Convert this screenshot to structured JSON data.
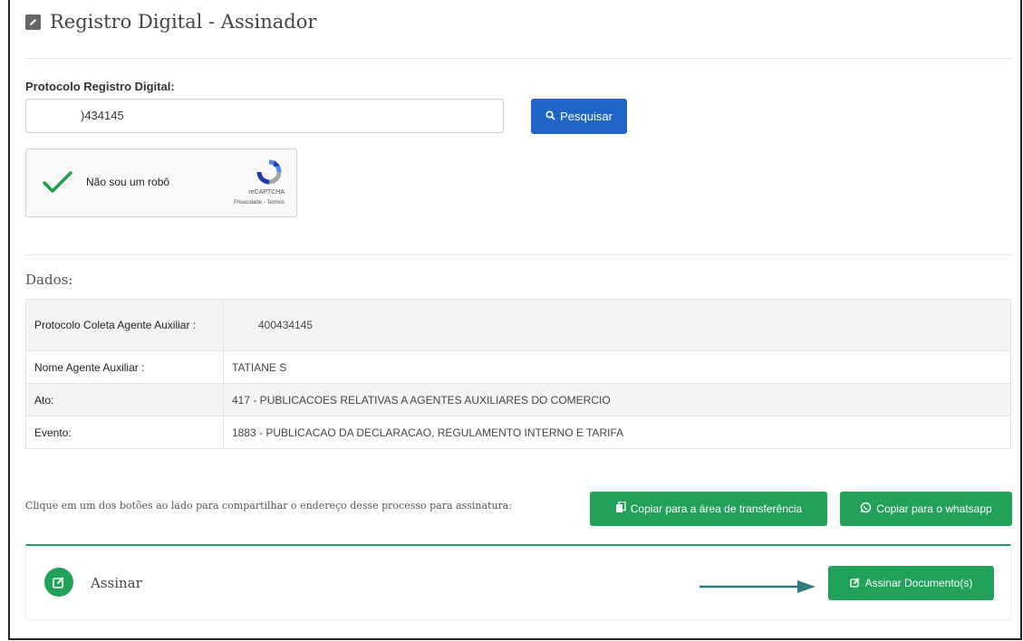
{
  "page": {
    "title": "Registro Digital - Assinador",
    "title_icon": "edit-icon"
  },
  "search": {
    "label": "Protocolo Registro Digital:",
    "value": ")434145",
    "button_label": "Pesquisar",
    "button_icon": "search-icon"
  },
  "recaptcha": {
    "label": "Não sou um robô",
    "checked": true,
    "brand": "reCAPTCHA",
    "links": "Privacidade - Termos"
  },
  "dados": {
    "title": "Dados:",
    "rows": [
      {
        "key": "Protocolo Coleta Agente Auxiliar :",
        "value": "400434145"
      },
      {
        "key": "Nome Agente Auxiliar :",
        "value": "TATIANE S"
      },
      {
        "key": "Ato:",
        "value": "417 - PUBLICACOES RELATIVAS A AGENTES AUXILIARES DO COMERCIO"
      },
      {
        "key": "Evento:",
        "value": "1883 - PUBLICACAO DA DECLARACAO, REGULAMENTO INTERNO E TARIFA"
      }
    ]
  },
  "share": {
    "text": "Clique em um dos botões ao lado para compartilhar o endereço desse processo para assinatura:",
    "copy_clipboard_label": "Copiar para a área de transferência",
    "copy_whatsapp_label": "Copiar para o whatsapp"
  },
  "sign": {
    "label": "Assinar",
    "button_label": "Assinar Documento(s)"
  },
  "colors": {
    "primary_blue": "#1f66c8",
    "success_green": "#21a15a",
    "arrow": "#2e7d7a"
  }
}
